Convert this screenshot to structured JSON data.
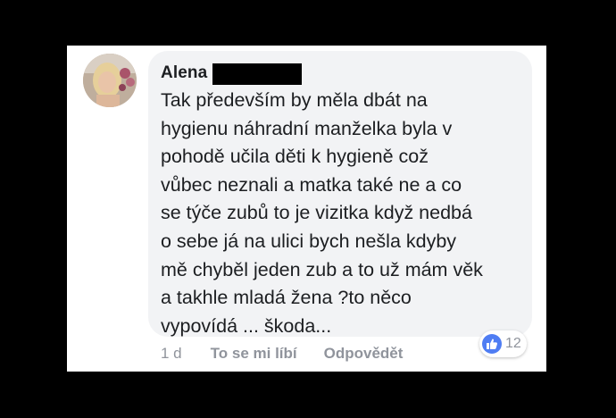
{
  "comment": {
    "author": "Alena",
    "text": "Tak především by měla dbát na\nhygienu náhradní manželka byla v\npohodě učila děti k hygieně což\nvůbec neznali a matka také ne a co\nse týče zubů to je vizitka když nedbá\no sebe já na ulici bych nešla kdyby\nmě chyběl jeden zub a to už mám věk\na takhle mladá žena ?to něco\nvypovídá ... škoda...",
    "time": "1 d",
    "like_label": "To se mi líbí",
    "reply_label": "Odpovědět",
    "reaction_count": "12"
  },
  "colors": {
    "page_background": "#000000",
    "bubble_background": "#f2f3f5",
    "text": "#1c1e21",
    "meta_text": "#90949c",
    "like_badge": "#4f7df3"
  },
  "icons": {
    "reaction": "thumbs-up-icon"
  }
}
